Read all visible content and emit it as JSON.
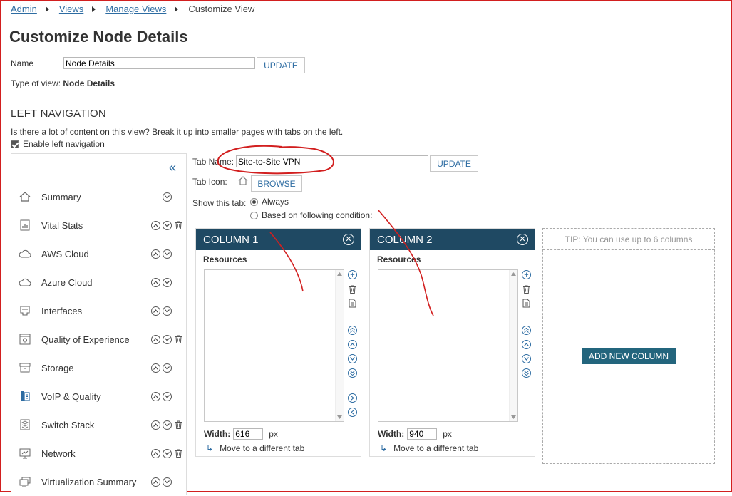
{
  "breadcrumb": {
    "items": [
      "Admin",
      "Views",
      "Manage Views"
    ],
    "current": "Customize View"
  },
  "page_title": "Customize Node Details",
  "name_field": {
    "label": "Name",
    "value": "Node Details",
    "button": "UPDATE"
  },
  "type_of_view": {
    "label": "Type of view:",
    "value": "Node Details"
  },
  "left_navigation": {
    "heading": "LEFT NAVIGATION",
    "description": "Is there a lot of content on this view? Break it up into smaller pages with tabs on the left.",
    "enable_label": "Enable left navigation",
    "items": [
      {
        "label": "Summary",
        "icon": "home-icon"
      },
      {
        "label": "Vital Stats",
        "icon": "chart-icon"
      },
      {
        "label": "AWS Cloud",
        "icon": "cloud-icon"
      },
      {
        "label": "Azure Cloud",
        "icon": "cloud-icon"
      },
      {
        "label": "Interfaces",
        "icon": "ethernet-port-icon"
      },
      {
        "label": "Quality of Experience",
        "icon": "qoe-icon"
      },
      {
        "label": "Storage",
        "icon": "storage-icon"
      },
      {
        "label": "VoIP & Quality",
        "icon": "phone-icon"
      },
      {
        "label": "Switch Stack",
        "icon": "stack-icon"
      },
      {
        "label": "Network",
        "icon": "monitor-icon"
      },
      {
        "label": "Virtualization Summary",
        "icon": "virtualization-icon"
      }
    ]
  },
  "tab_settings": {
    "tab_name_label": "Tab Name:",
    "tab_name_value": "Site-to-Site VPN",
    "update_button": "UPDATE",
    "tab_icon_label": "Tab Icon:",
    "browse_button": "BROWSE",
    "show_tab_label": "Show this tab:",
    "option_always": "Always",
    "option_condition": "Based on following condition:"
  },
  "columns": [
    {
      "title": "COLUMN 1",
      "resources_label": "Resources",
      "width_label": "Width:",
      "width_value": "616",
      "unit": "px",
      "move_label": "Move to a different tab"
    },
    {
      "title": "COLUMN 2",
      "resources_label": "Resources",
      "width_label": "Width:",
      "width_value": "940",
      "unit": "px",
      "move_label": "Move to a different tab"
    }
  ],
  "tip": "TIP: You can use up to 6 columns",
  "add_column_button": "ADD NEW COLUMN",
  "colors": {
    "accent": "#2d6ca2",
    "column_header": "#1f4963",
    "primary_button": "#23657d",
    "annotation": "#d21f1f"
  }
}
